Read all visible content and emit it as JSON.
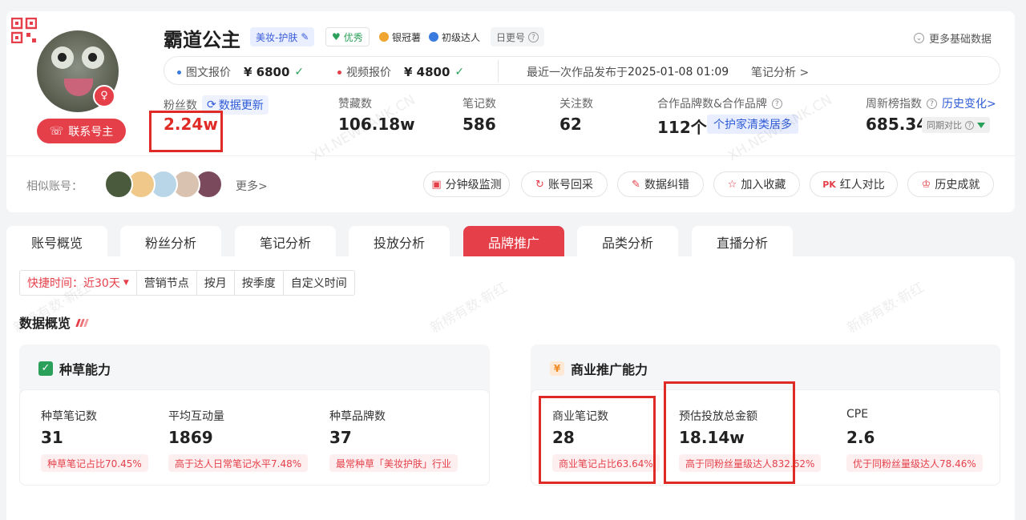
{
  "profile": {
    "name": "霸道公主",
    "category_tag": "美妆-护肤",
    "quality_tag": "优秀",
    "medal_tag": "银冠薯",
    "level_tag": "初级达人",
    "update_tag": "日更号",
    "contact_label": "联系号主",
    "more_basic_label": "更多基础数据"
  },
  "price_bar": {
    "image_label": "图文报价",
    "image_price": "¥ 6800",
    "video_label": "视频报价",
    "video_price": "¥ 4800",
    "latest_label": "最近一次作品发布于",
    "latest_time": "2025-01-08 01:09",
    "note_analysis_link": "笔记分析 >"
  },
  "stats": {
    "fans_label": "粉丝数",
    "fans_update": "数据更新",
    "fans_value": "2.24w",
    "likes_label": "赞藏数",
    "likes_value": "106.18w",
    "notes_label": "笔记数",
    "notes_value": "586",
    "follow_label": "关注数",
    "follow_value": "62",
    "brand_label": "合作品牌数&合作品牌",
    "brand_value": "112个",
    "brand_chip": "个护家清类居多",
    "rank_label": "周新榜指数",
    "rank_link": "历史变化>",
    "rank_value": "685.34",
    "compare_label": "同期对比"
  },
  "similar": {
    "label": "相似账号：",
    "more": "更多>",
    "avatar_colors": [
      "#4a5a3c",
      "#f0c98a",
      "#b8d6e8",
      "#d9c3b0",
      "#7a4a5c"
    ]
  },
  "actions": [
    "分钟级监测",
    "账号回采",
    "数据纠错",
    "加入收藏",
    "红人对比",
    "历史成就"
  ],
  "tabs": [
    "账号概览",
    "粉丝分析",
    "笔记分析",
    "投放分析",
    "品牌推广",
    "品类分析",
    "直播分析"
  ],
  "active_tab": "品牌推广",
  "time_filter": {
    "quick_prefix": "快捷时间：",
    "quick_value": "近30天",
    "options": [
      "营销节点",
      "按月",
      "按季度",
      "自定义时间"
    ]
  },
  "overview_title": "数据概览",
  "seeding": {
    "title": "种草能力",
    "metrics": [
      {
        "label": "种草笔记数",
        "value": "31",
        "badge": "种草笔记占比70.45%"
      },
      {
        "label": "平均互动量",
        "value": "1869",
        "badge": "高于达人日常笔记水平7.48%"
      },
      {
        "label": "种草品牌数",
        "value": "37",
        "badge": "最常种草「美妆护肤」行业"
      }
    ]
  },
  "commercial": {
    "title": "商业推广能力",
    "metrics": [
      {
        "label": "商业笔记数",
        "value": "28",
        "badge": "商业笔记占比63.64%"
      },
      {
        "label": "预估投放总金额",
        "value": "18.14w",
        "badge": "高于同粉丝量级达人832.62%"
      },
      {
        "label": "CPE",
        "value": "2.6",
        "badge": "优于同粉丝量级达人78.46%"
      }
    ]
  },
  "watermarks": [
    "XH.NEWRANK.CN",
    "新榜有数·新红"
  ],
  "colors": {
    "accent": "#e5404a",
    "link": "#2f5bd6",
    "positive": "#2aa05a",
    "highlight": "#e02a25"
  }
}
